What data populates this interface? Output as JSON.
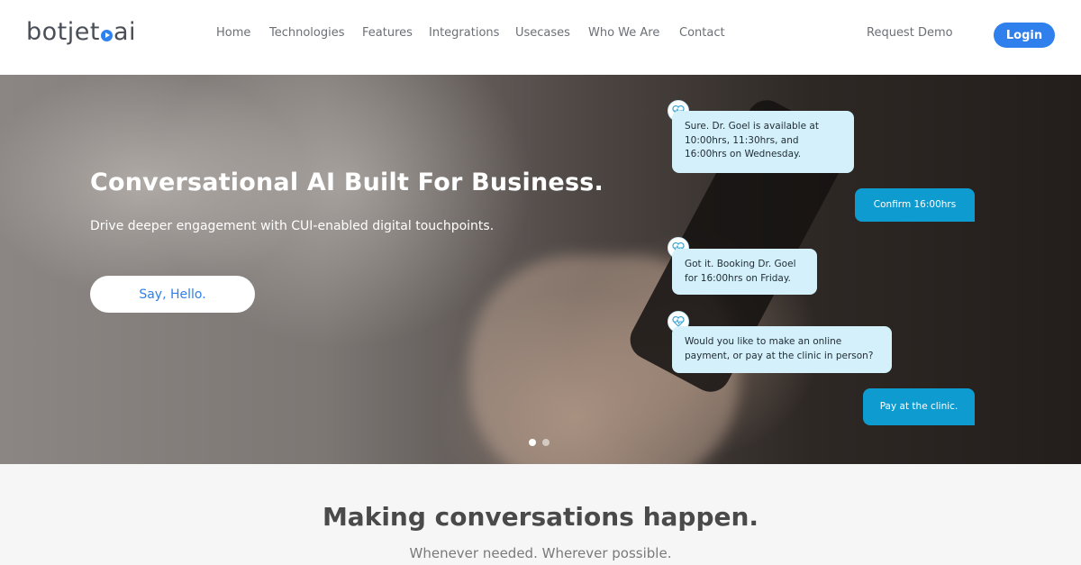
{
  "header": {
    "logo_text_a": "botjet",
    "logo_text_b": "ai",
    "nav": [
      "Home",
      "Technologies",
      "Features",
      "Integrations",
      "Usecases",
      "Who We Are",
      "Contact"
    ],
    "request_demo": "Request Demo",
    "login": "Login"
  },
  "hero": {
    "title": "Conversational AI Built For Business.",
    "subtitle": "Drive deeper engagement with CUI-enabled digital touchpoints.",
    "cta": "Say, Hello.",
    "chat": [
      {
        "from": "bot",
        "text": "Sure. Dr. Goel is available at 10:00hrs, 11:30hrs, and 16:00hrs on Wednesday."
      },
      {
        "from": "user",
        "text": "Confirm 16:00hrs"
      },
      {
        "from": "bot",
        "text": "Got it. Booking Dr. Goel for 16:00hrs on Friday."
      },
      {
        "from": "bot",
        "text": "Would you like to make an online payment, or pay at the clinic in person?"
      },
      {
        "from": "user",
        "text": "Pay at the clinic."
      }
    ],
    "carousel": {
      "total": 2,
      "active": 1
    }
  },
  "section": {
    "title": "Making conversations happen.",
    "subtitle": "Whenever needed. Wherever possible."
  },
  "colors": {
    "accent": "#2f80ed",
    "bot_bubble": "#d4f1fb",
    "user_bubble": "#0e9bd0",
    "icon": "heart-pulse-icon"
  }
}
